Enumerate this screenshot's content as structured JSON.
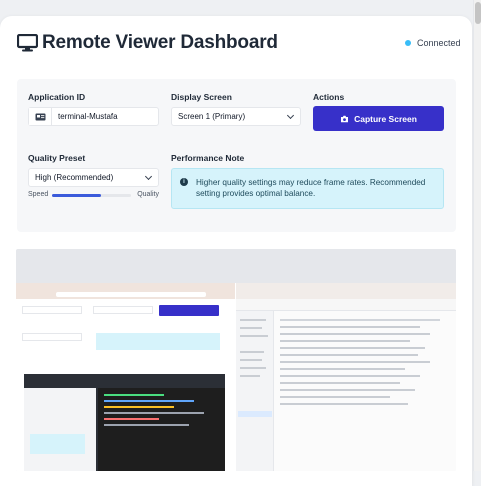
{
  "header": {
    "title": "Remote Viewer Dashboard",
    "icon": "monitor-icon"
  },
  "status": {
    "text": "Connected",
    "color": "#38bdf8"
  },
  "controls": {
    "app_id_label": "Application ID",
    "app_id_value": "terminal-Mustafa",
    "display_label": "Display Screen",
    "display_value": "Screen 1 (Primary)",
    "actions_label": "Actions",
    "capture_label": "Capture Screen",
    "quality_label": "Quality Preset",
    "quality_value": "High (Recommended)",
    "slider_left": "Speed",
    "slider_right": "Quality",
    "slider_level": 0.62,
    "perf_label": "Performance Note",
    "perf_note": "Higher quality settings may reduce frame rates. Recommended setting provides optimal balance."
  },
  "colors": {
    "accent": "#3730c9",
    "note_bg": "#d6f3fb"
  }
}
